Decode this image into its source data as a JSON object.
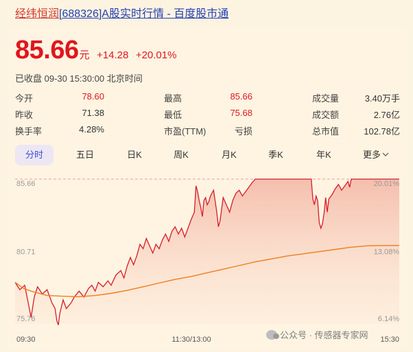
{
  "header": {
    "name_link": "经纬恒润",
    "rest_link": "[688326]A股实时行情 - 百度股市通"
  },
  "quote": {
    "price": "85.66",
    "unit": "元",
    "change": "+14.28",
    "change_pct": "+20.01%",
    "status": "已收盘 09-30 15:30:00 北京时间"
  },
  "stats": {
    "row1": [
      {
        "label": "今开",
        "value": "78.60"
      },
      {
        "label": "最高",
        "value": "85.66"
      },
      {
        "label": "成交量",
        "value": "3.40万手"
      }
    ],
    "row2": [
      {
        "label": "昨收",
        "value": "71.38"
      },
      {
        "label": "最低",
        "value": "75.68"
      },
      {
        "label": "成交额",
        "value": "2.76亿"
      }
    ],
    "row3": [
      {
        "label": "换手率",
        "value": "4.28%"
      },
      {
        "label": "市盈(TTM)",
        "value": "亏损"
      },
      {
        "label": "总市值",
        "value": "102.78亿"
      }
    ]
  },
  "tabs": [
    "分时",
    "五日",
    "日K",
    "周K",
    "月K",
    "季K",
    "年K",
    "更多"
  ],
  "colors": {
    "up": "#e0161d",
    "avg_line": "#f07d1a",
    "active_tab": "#3d4fd6",
    "limit_dashed": "#f29a9a"
  },
  "chart_data": {
    "type": "line",
    "y_left_ticks": [
      "85.66",
      "80.71",
      "75.76"
    ],
    "y_right_ticks": [
      "20.01%",
      "13.08%",
      "6.14%"
    ],
    "x_ticks": [
      "09:30",
      "11:30/13:00",
      "15:30"
    ],
    "ylim": [
      75.76,
      85.66
    ],
    "x_points": 241,
    "series": [
      {
        "values": [
          [
            0,
            78.6
          ],
          [
            3,
            78.1
          ],
          [
            6,
            78.4
          ],
          [
            8,
            77.3
          ],
          [
            10,
            76.2
          ],
          [
            12,
            77.6
          ],
          [
            14,
            78.3
          ],
          [
            17,
            77.8
          ],
          [
            20,
            78.1
          ],
          [
            23,
            77.2
          ],
          [
            25,
            76.8
          ],
          [
            26,
            76.0
          ],
          [
            27,
            75.68
          ],
          [
            28,
            76.5
          ],
          [
            30,
            77.4
          ],
          [
            32,
            76.8
          ],
          [
            35,
            77.2
          ],
          [
            37,
            77.6
          ],
          [
            40,
            78.0
          ],
          [
            43,
            77.6
          ],
          [
            46,
            78.2
          ],
          [
            48,
            78.4
          ],
          [
            50,
            78.0
          ],
          [
            52,
            78.6
          ],
          [
            55,
            78.3
          ],
          [
            58,
            78.7
          ],
          [
            60,
            78.4
          ],
          [
            63,
            79.1
          ],
          [
            66,
            79.4
          ],
          [
            68,
            78.9
          ],
          [
            70,
            79.7
          ],
          [
            72,
            80.3
          ],
          [
            74,
            79.8
          ],
          [
            76,
            80.4
          ],
          [
            78,
            81.2
          ],
          [
            80,
            80.9
          ],
          [
            82,
            81.6
          ],
          [
            84,
            81.1
          ],
          [
            86,
            80.6
          ],
          [
            88,
            81.2
          ],
          [
            90,
            80.9
          ],
          [
            92,
            81.5
          ],
          [
            94,
            81.9
          ],
          [
            96,
            81.4
          ],
          [
            98,
            82.1
          ],
          [
            100,
            82.4
          ],
          [
            102,
            81.9
          ],
          [
            104,
            82.3
          ],
          [
            106,
            81.7
          ],
          [
            108,
            82.3
          ],
          [
            110,
            82.9
          ],
          [
            112,
            83.4
          ],
          [
            113,
            85.2
          ],
          [
            114,
            84.8
          ],
          [
            115,
            84.2
          ],
          [
            116,
            83.7
          ],
          [
            117,
            83.1
          ],
          [
            118,
            84.2
          ],
          [
            119,
            84.4
          ],
          [
            120,
            83.9
          ],
          [
            121,
            84.1
          ],
          [
            122,
            84.5
          ],
          [
            124,
            84.9
          ],
          [
            126,
            83.4
          ],
          [
            127,
            82.4
          ],
          [
            128,
            82.8
          ],
          [
            130,
            84.4
          ],
          [
            132,
            83.9
          ],
          [
            134,
            83.4
          ],
          [
            136,
            84.2
          ],
          [
            138,
            84.7
          ],
          [
            140,
            84.9
          ],
          [
            142,
            84.5
          ],
          [
            144,
            84.8
          ],
          [
            146,
            85.1
          ],
          [
            148,
            85.4
          ],
          [
            150,
            85.66
          ],
          [
            160,
            85.66
          ],
          [
            170,
            85.66
          ],
          [
            180,
            85.66
          ],
          [
            185,
            85.66
          ],
          [
            186,
            84.3
          ],
          [
            187,
            83.9
          ],
          [
            188,
            84.5
          ],
          [
            189,
            84.2
          ],
          [
            190,
            82.7
          ],
          [
            191,
            82.3
          ],
          [
            192,
            82.6
          ],
          [
            193,
            83.3
          ],
          [
            194,
            84.4
          ],
          [
            195,
            83.4
          ],
          [
            196,
            84.3
          ],
          [
            198,
            84.6
          ],
          [
            200,
            85.0
          ],
          [
            202,
            85.3
          ],
          [
            204,
            84.9
          ],
          [
            206,
            85.2
          ],
          [
            208,
            85.5
          ],
          [
            209,
            85.1
          ],
          [
            210,
            85.66
          ],
          [
            220,
            85.66
          ],
          [
            230,
            85.66
          ],
          [
            240,
            85.66
          ]
        ]
      },
      {
        "values": [
          [
            0,
            78.6
          ],
          [
            5,
            78.2
          ],
          [
            10,
            78.0
          ],
          [
            20,
            77.7
          ],
          [
            30,
            77.65
          ],
          [
            40,
            77.62
          ],
          [
            50,
            77.7
          ],
          [
            60,
            77.85
          ],
          [
            70,
            78.05
          ],
          [
            80,
            78.3
          ],
          [
            90,
            78.55
          ],
          [
            100,
            78.8
          ],
          [
            110,
            79.0
          ],
          [
            120,
            79.25
          ],
          [
            130,
            79.5
          ],
          [
            140,
            79.75
          ],
          [
            150,
            80.0
          ],
          [
            160,
            80.2
          ],
          [
            170,
            80.4
          ],
          [
            180,
            80.55
          ],
          [
            190,
            80.7
          ],
          [
            200,
            80.85
          ],
          [
            210,
            81.0
          ],
          [
            220,
            81.1
          ],
          [
            230,
            81.12
          ],
          [
            240,
            81.12
          ]
        ]
      }
    ]
  }
}
